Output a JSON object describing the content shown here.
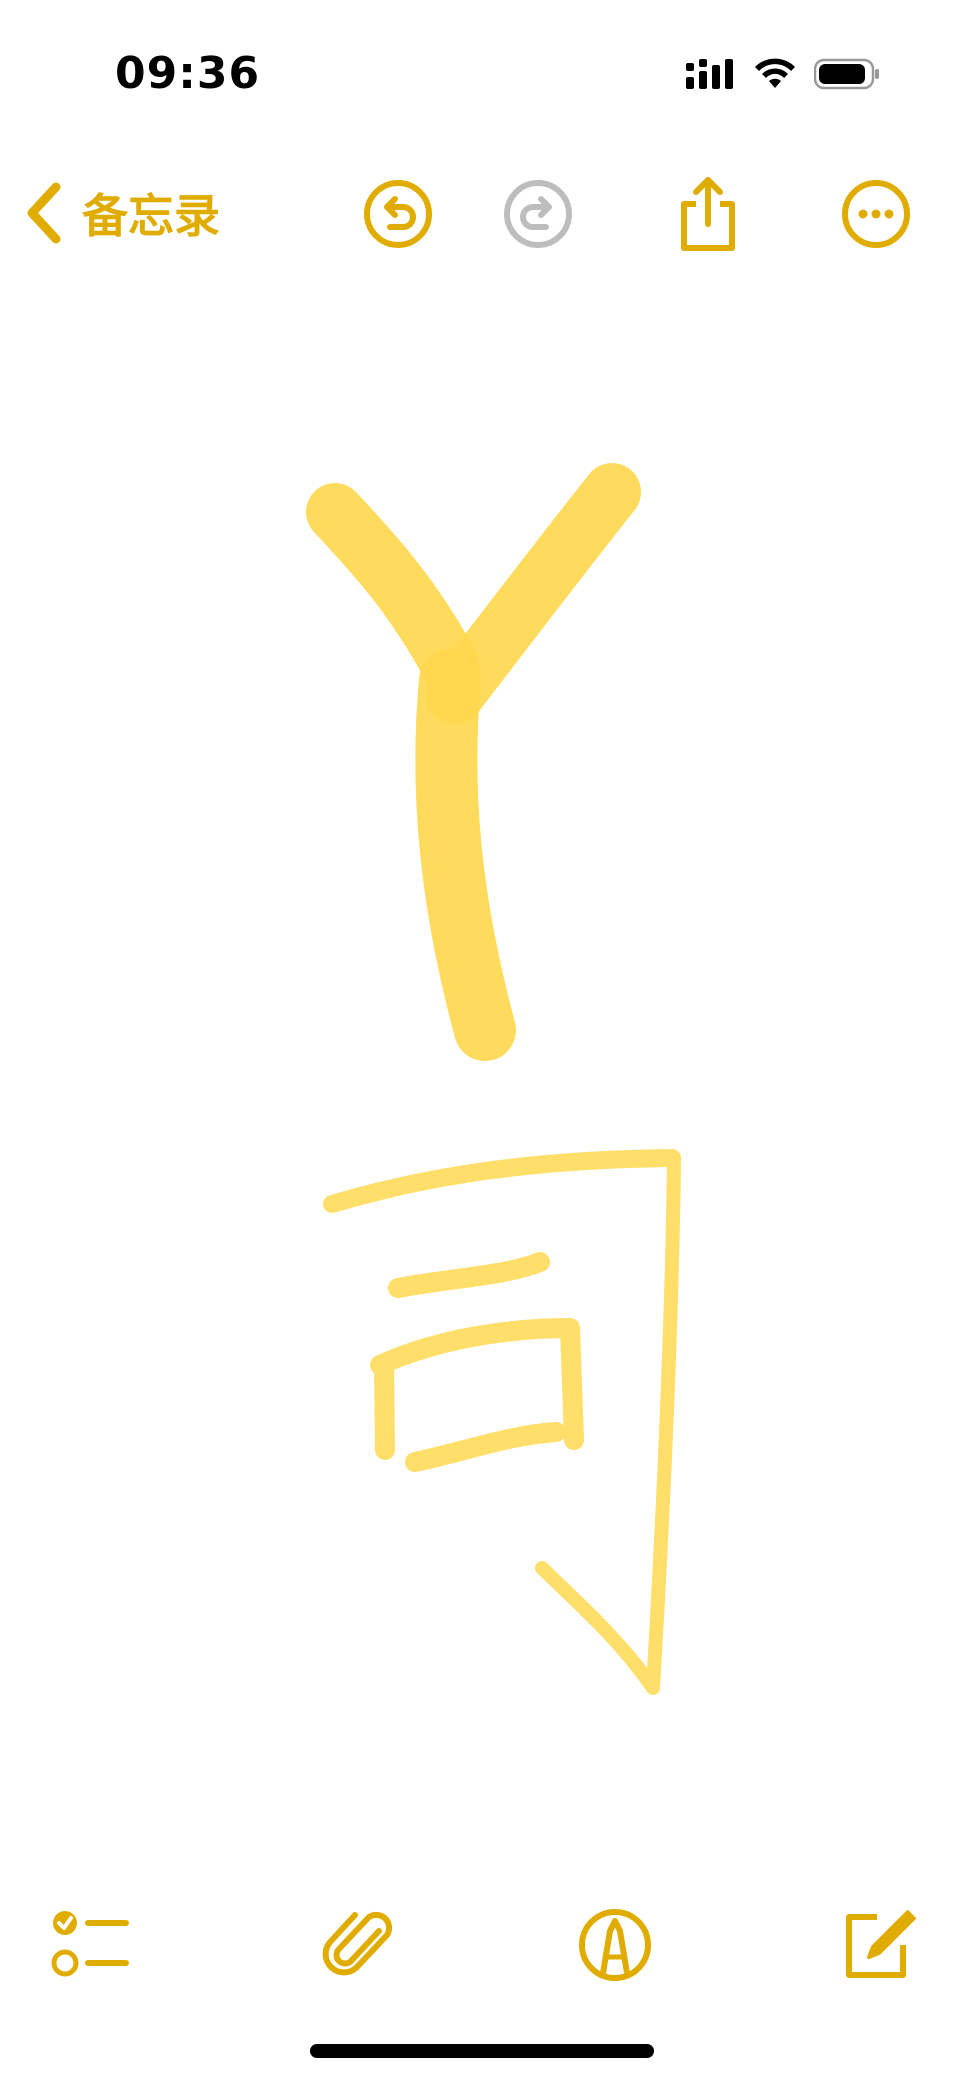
{
  "status_bar": {
    "time": "09:36",
    "icons": [
      "cellular-signal-icon",
      "wifi-icon",
      "battery-icon"
    ]
  },
  "nav": {
    "back_label": "备忘录",
    "buttons": [
      "undo-icon",
      "redo-icon",
      "share-icon",
      "more-icon"
    ]
  },
  "toolbar": {
    "buttons": [
      "checklist-icon",
      "attachment-icon",
      "markup-pen-icon",
      "compose-icon"
    ]
  },
  "colors": {
    "accent": "#E1AC00",
    "disabled": "#BDBDBD",
    "ink": "#FFD84F"
  }
}
